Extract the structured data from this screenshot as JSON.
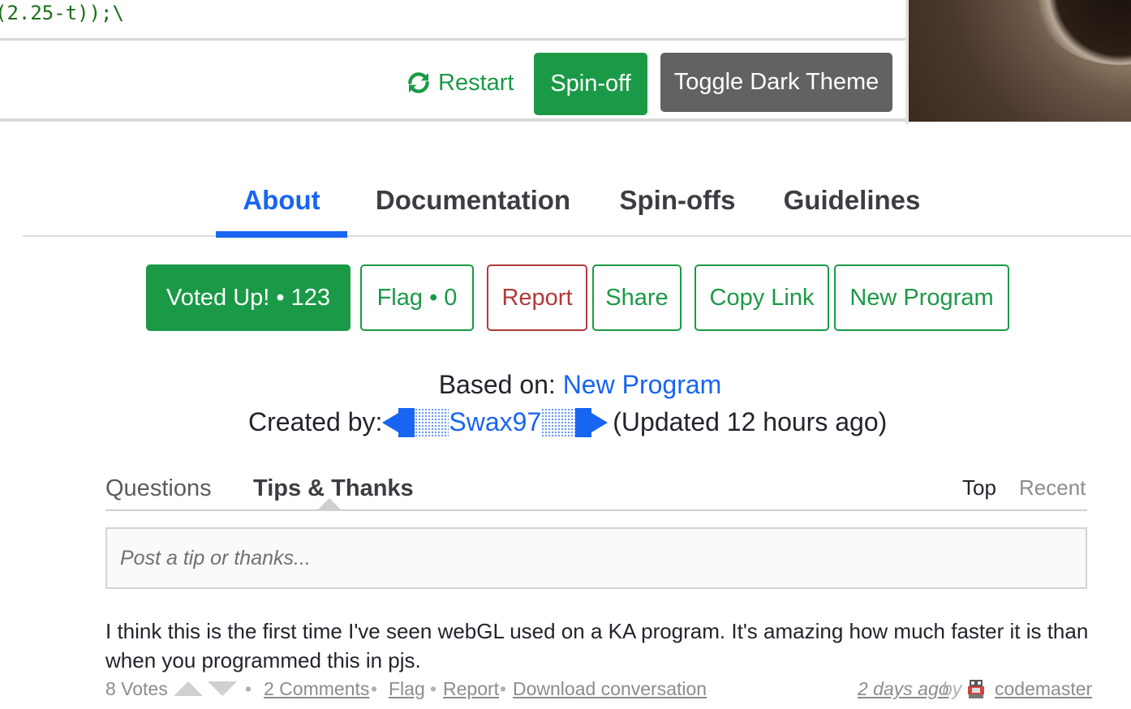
{
  "editor": {
    "code_line": "(2.25-t));\\"
  },
  "toolbar": {
    "restart_label": "Restart",
    "spinoff_label": "Spin-off",
    "dark_theme_label": "Toggle Dark Theme"
  },
  "tabs": [
    {
      "label": "About",
      "active": true
    },
    {
      "label": "Documentation",
      "active": false
    },
    {
      "label": "Spin-offs",
      "active": false
    },
    {
      "label": "Guidelines",
      "active": false
    }
  ],
  "actions": {
    "vote_label": "Voted Up! • 123",
    "flag_label": "Flag • 0",
    "report_label": "Report",
    "share_label": "Share",
    "copy_link_label": "Copy Link",
    "new_program_label": "New Program"
  },
  "meta": {
    "based_on_prefix": "Based on: ",
    "based_on_link": "New Program",
    "created_by_prefix": "Created by: ",
    "author": "Swax97",
    "updated": "(Updated 12 hours ago)"
  },
  "discussion": {
    "tab_questions": "Questions",
    "tab_tips": "Tips & Thanks",
    "sort_top": "Top",
    "sort_recent": "Recent",
    "input_placeholder": "Post a tip or thanks...",
    "post": {
      "text": "I think this is the first time I've seen webGL used on a KA program. It's amazing how much faster it is than when you programmed this in pjs.",
      "votes": "8 Votes",
      "comments": "2 Comments",
      "flag": "Flag",
      "report": "Report",
      "download": "Download conversation",
      "time": "2 days ago",
      "by": "by",
      "user": "codemaster"
    }
  },
  "colors": {
    "green": "#1a9a47",
    "blue": "#1865f2",
    "red": "#b03a3a",
    "gray_button": "#626262"
  }
}
